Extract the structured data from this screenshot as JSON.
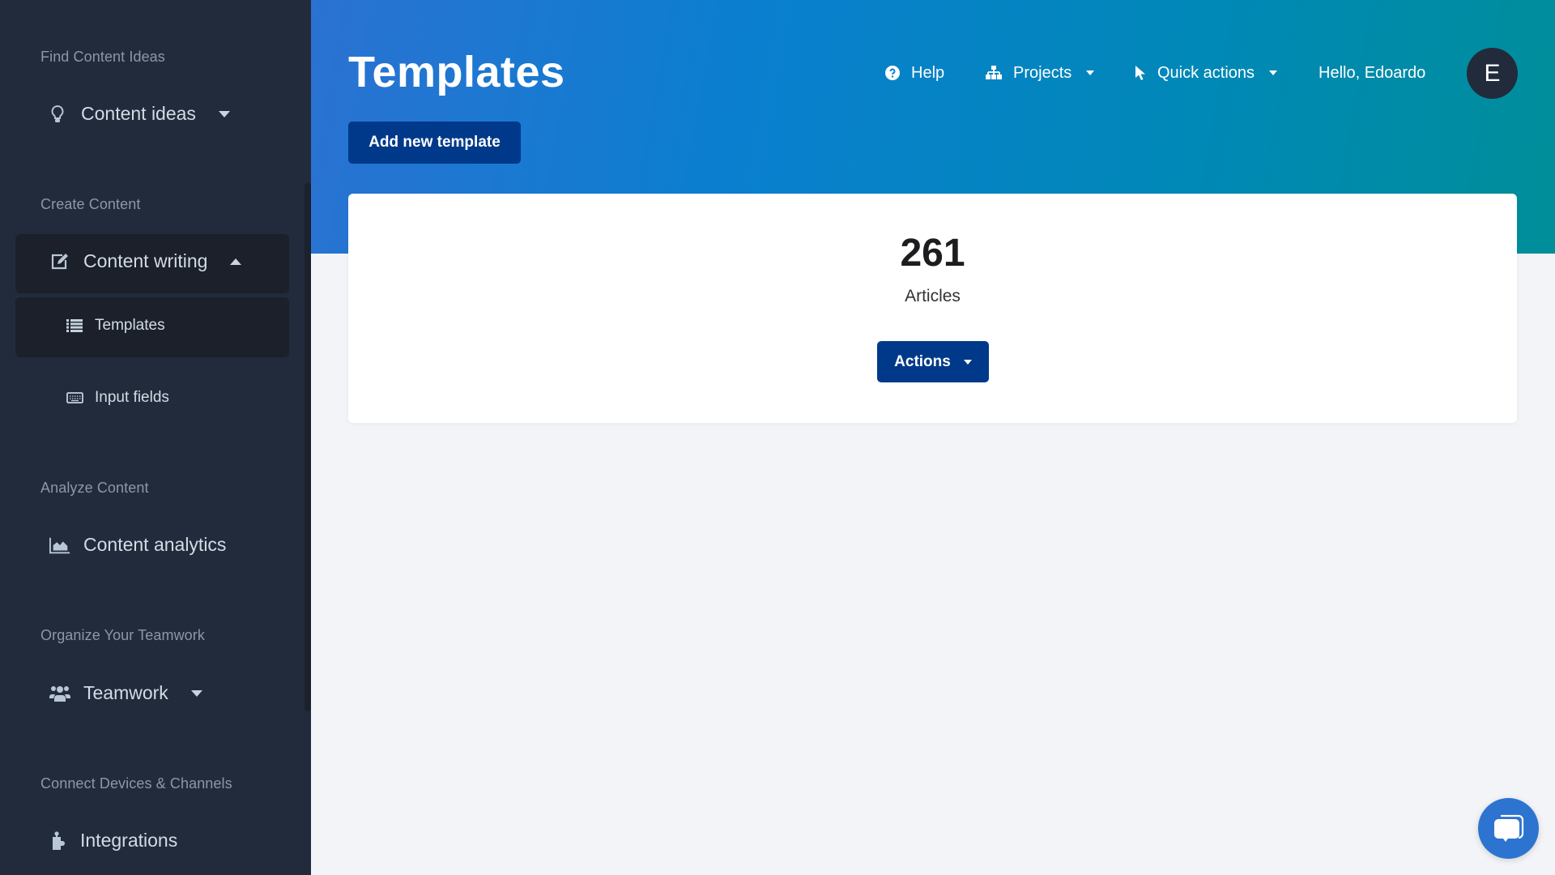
{
  "sidebar": {
    "sections": [
      {
        "heading": "Find Content Ideas"
      },
      {
        "heading": "Create Content"
      },
      {
        "heading": "Analyze Content"
      },
      {
        "heading": "Organize Your Teamwork"
      },
      {
        "heading": "Connect Devices & Channels"
      }
    ],
    "items": {
      "content_ideas": {
        "label": "Content ideas",
        "icon": "lightbulb-icon"
      },
      "content_writing": {
        "label": "Content writing",
        "icon": "edit-icon",
        "expanded": true
      },
      "templates": {
        "label": "Templates",
        "icon": "list-icon",
        "active": true
      },
      "input_fields": {
        "label": "Input fields",
        "icon": "keyboard-icon"
      },
      "content_analytics": {
        "label": "Content analytics",
        "icon": "area-chart-icon"
      },
      "teamwork": {
        "label": "Teamwork",
        "icon": "users-icon"
      },
      "integrations": {
        "label": "Integrations",
        "icon": "puzzle-icon"
      }
    }
  },
  "header": {
    "title": "Templates",
    "add_button": "Add new template",
    "nav": {
      "help": "Help",
      "projects": "Projects",
      "quick_actions": "Quick actions",
      "greeting": "Hello, Edoardo"
    },
    "avatar_initial": "E"
  },
  "card": {
    "count": "261",
    "count_label": "Articles",
    "actions_button": "Actions"
  },
  "colors": {
    "sidebar_bg": "#222b3b",
    "primary_button": "#00398a",
    "header_gradient_start": "#2b72d2",
    "header_gradient_end": "#008e99",
    "chat_button": "#2d74d0"
  }
}
